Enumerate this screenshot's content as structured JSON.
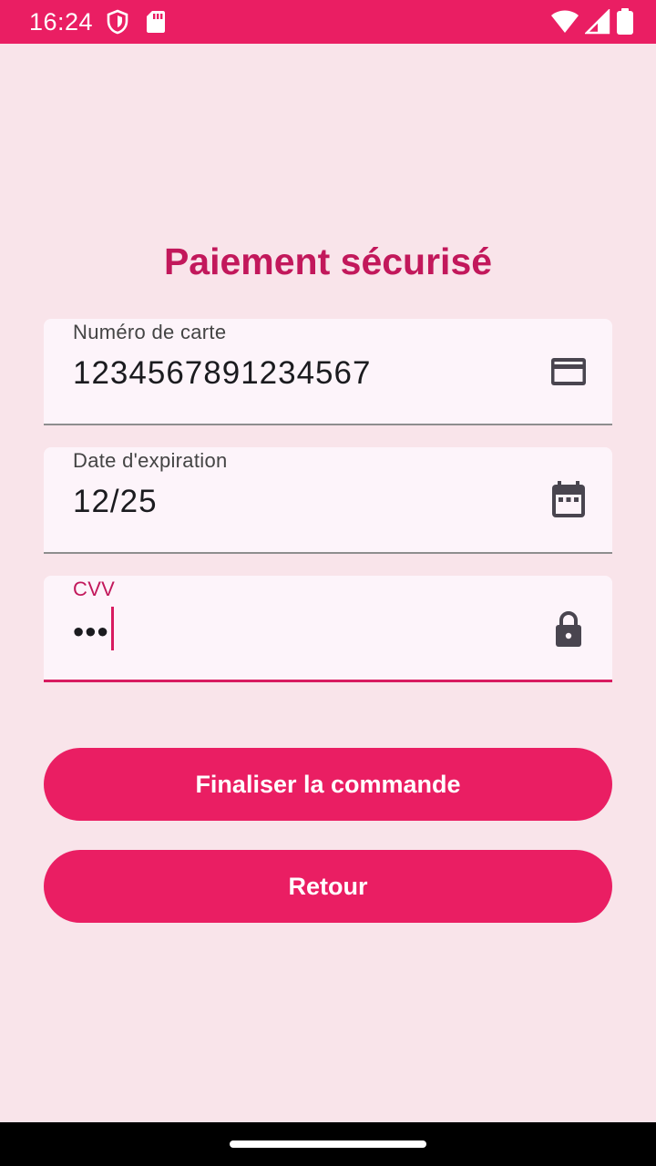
{
  "status_bar": {
    "time": "16:24",
    "icons": [
      "shield-icon",
      "sd-card-icon",
      "wifi-icon",
      "signal-icon",
      "battery-icon"
    ]
  },
  "page": {
    "title": "Paiement sécurisé"
  },
  "form": {
    "card_number": {
      "label": "Numéro de carte",
      "value": "1234567891234567",
      "icon": "credit-card-icon"
    },
    "expiry": {
      "label": "Date d'expiration",
      "value": "12/25",
      "icon": "calendar-icon"
    },
    "cvv": {
      "label": "CVV",
      "value": "•••",
      "icon": "lock-icon"
    }
  },
  "actions": {
    "submit_label": "Finaliser la commande",
    "back_label": "Retour"
  },
  "colors": {
    "primary": "#EA1E63",
    "title": "#C2185B",
    "background": "#F9E4EA",
    "field_background": "#FDF4FA"
  }
}
